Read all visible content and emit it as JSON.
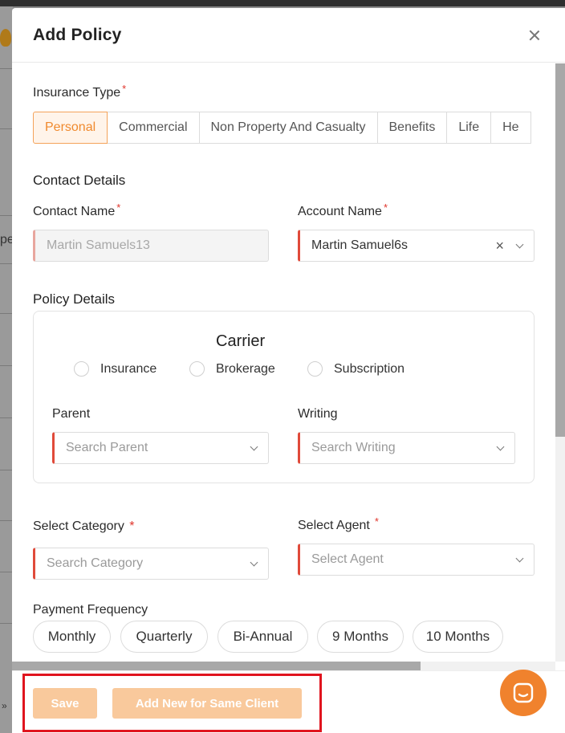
{
  "modal": {
    "title": "Add Policy"
  },
  "insurance_type": {
    "label": "Insurance Type",
    "required_mark": "*",
    "tabs": [
      "Personal",
      "Commercial",
      "Non Property And Casualty",
      "Benefits",
      "Life",
      "He"
    ],
    "selected": "Personal"
  },
  "contact_details": {
    "title": "Contact Details",
    "contact_name": {
      "label": "Contact Name",
      "required_mark": "*",
      "placeholder": "Martin Samuels13"
    },
    "account_name": {
      "label": "Account Name",
      "required_mark": "*",
      "value": "Martin Samuel6s"
    }
  },
  "policy_details": {
    "title": "Policy Details",
    "carrier": {
      "title": "Carrier",
      "options": [
        "Insurance",
        "Brokerage",
        "Subscription"
      ]
    },
    "parent": {
      "label": "Parent",
      "placeholder": "Search Parent"
    },
    "writing": {
      "label": "Writing",
      "placeholder": "Search Writing"
    }
  },
  "category": {
    "label": "Select Category",
    "required_mark": "*",
    "placeholder": "Search Category"
  },
  "agent": {
    "label": "Select Agent",
    "required_mark": "*",
    "placeholder": "Select Agent"
  },
  "payment_frequency": {
    "label": "Payment Frequency",
    "options": [
      "Monthly",
      "Quarterly",
      "Bi-Annual",
      "9 Months",
      "10 Months"
    ]
  },
  "footer": {
    "save_label": "Save",
    "add_new_label": "Add New for Same Client"
  },
  "backdrop": {
    "partial_text": "pe",
    "partial_chevron": "»"
  },
  "colors": {
    "accent": "#f08a2e",
    "required": "#e0352b",
    "button_disabled": "#f9c99c",
    "highlight": "#e0141e"
  }
}
